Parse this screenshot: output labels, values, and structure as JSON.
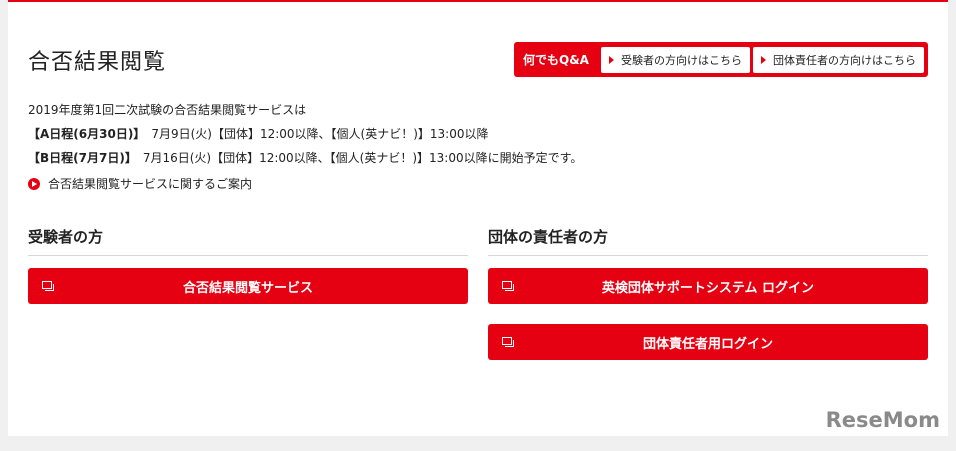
{
  "header": {
    "title": "合否結果閲覧",
    "qa_label": "何でもQ&A",
    "links": [
      {
        "label": "受験者の方向けはこちら"
      },
      {
        "label": "団体責任者の方向けはこちら"
      }
    ]
  },
  "intro": {
    "line1": "2019年度第1回二次試験の合否結果閲覧サービスは",
    "line2_bold": "【A日程(6月30日)】",
    "line2_rest": "　7月9日(火)【団体】12:00以降、【個人(英ナビ！)】13:00以降",
    "line3_bold": "【B日程(7月7日)】",
    "line3_rest": "　7月16日(火)【団体】12:00以降、【個人(英ナビ！)】13:00以降に開始予定です。"
  },
  "guide_link": "合否結果閲覧サービスに関するご案内",
  "sections": {
    "examinee": {
      "heading": "受験者の方",
      "buttons": [
        "合否結果閲覧サービス"
      ]
    },
    "group": {
      "heading": "団体の責任者の方",
      "buttons": [
        "英検団体サポートシステム ログイン",
        "団体責任者用ログイン"
      ]
    }
  },
  "watermark": "ReseMom",
  "colors": {
    "accent": "#e50012"
  }
}
